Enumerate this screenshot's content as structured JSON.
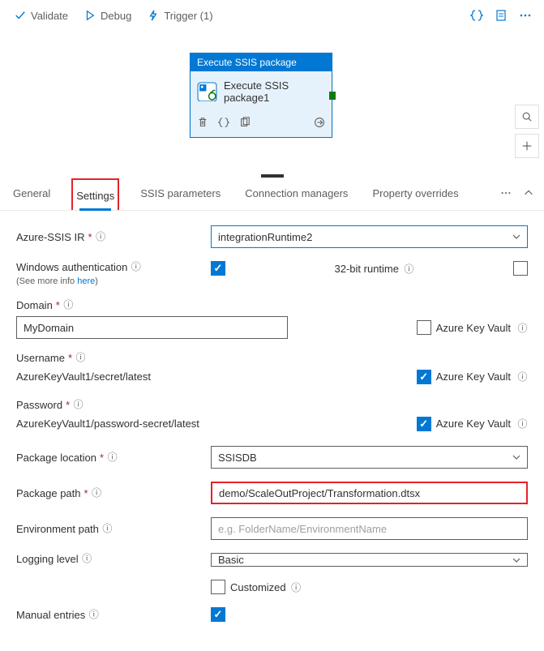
{
  "toolbar": {
    "validate": "Validate",
    "debug": "Debug",
    "trigger": "Trigger (1)"
  },
  "node": {
    "header": "Execute SSIS package",
    "title": "Execute SSIS package1"
  },
  "tabs": {
    "general": "General",
    "settings": "Settings",
    "ssis_params": "SSIS parameters",
    "conn_managers": "Connection managers",
    "prop_overrides": "Property overrides"
  },
  "form": {
    "azure_ssis_ir": {
      "label": "Azure-SSIS IR",
      "value": "integrationRuntime2"
    },
    "win_auth": {
      "label": "Windows authentication",
      "sub_prefix": "(See more info ",
      "sub_link": "here",
      "sub_suffix": ")"
    },
    "bit32": {
      "label": "32-bit runtime"
    },
    "domain": {
      "label": "Domain",
      "value": "MyDomain"
    },
    "akv": "Azure Key Vault",
    "username": {
      "label": "Username",
      "value": "AzureKeyVault1/secret/latest"
    },
    "password": {
      "label": "Password",
      "value": "AzureKeyVault1/password-secret/latest"
    },
    "pkg_location": {
      "label": "Package location",
      "value": "SSISDB"
    },
    "pkg_path": {
      "label": "Package path",
      "value": "demo/ScaleOutProject/Transformation.dtsx"
    },
    "env_path": {
      "label": "Environment path",
      "placeholder": "e.g. FolderName/EnvironmentName"
    },
    "log_level": {
      "label": "Logging level",
      "value": "Basic",
      "customized": "Customized"
    },
    "manual_entries": {
      "label": "Manual entries"
    }
  }
}
